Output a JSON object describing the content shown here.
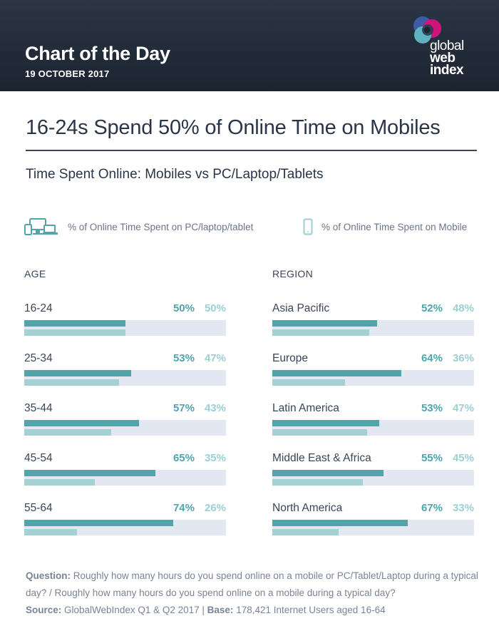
{
  "header": {
    "title": "Chart of the Day",
    "date": "19 OCTOBER 2017",
    "logo": {
      "line1": "global",
      "line2": "web",
      "line3": "index"
    }
  },
  "main_title": "16-24s Spend 50% of Online Time on Mobiles",
  "subtitle": "Time Spent Online: Mobiles vs PC/Laptop/Tablets",
  "legend": {
    "pc": {
      "icon": "devices-icon",
      "label": "% of Online Time Spent on PC/laptop/tablet",
      "color": "#50a4aa"
    },
    "mobile": {
      "icon": "mobile-phone-icon",
      "label": "% of Online Time Spent on Mobile",
      "color": "#a5d1d4"
    }
  },
  "colors": {
    "pc": "#50a4aa",
    "mobile": "#a5d1d4",
    "track": "#e3e7f1",
    "header_bg": "#222b38"
  },
  "chart_data": [
    {
      "type": "bar",
      "title": "AGE",
      "categories": [
        "16-24",
        "25-34",
        "35-44",
        "45-54",
        "55-64"
      ],
      "series": [
        {
          "name": "% of Online Time Spent on PC/laptop/tablet",
          "values": [
            50,
            53,
            57,
            65,
            74
          ]
        },
        {
          "name": "% of Online Time Spent on Mobile",
          "values": [
            50,
            47,
            43,
            35,
            26
          ]
        }
      ],
      "xlim": [
        0,
        100
      ],
      "orientation": "horizontal",
      "legend": "top"
    },
    {
      "type": "bar",
      "title": "REGION",
      "categories": [
        "Asia Pacific",
        "Europe",
        "Latin America",
        "Middle East & Africa",
        "North America"
      ],
      "series": [
        {
          "name": "% of Online Time Spent on PC/laptop/tablet",
          "values": [
            52,
            64,
            53,
            55,
            67
          ]
        },
        {
          "name": "% of Online Time Spent on Mobile",
          "values": [
            48,
            36,
            47,
            45,
            33
          ]
        }
      ],
      "xlim": [
        0,
        100
      ],
      "orientation": "horizontal",
      "legend": "top"
    }
  ],
  "footer": {
    "question_label": "Question:",
    "question_text": " Roughly how many hours do you spend online on a mobile or PC/Tablet/Laptop during a typical day? / Roughly how many hours do you spend online on a mobile during a typical day?",
    "source_label": "Source:",
    "source_text": " GlobalWebIndex Q1 & Q2 2017 | ",
    "base_label": "Base:",
    "base_text": " 178,421 Internet Users aged 16-64"
  }
}
